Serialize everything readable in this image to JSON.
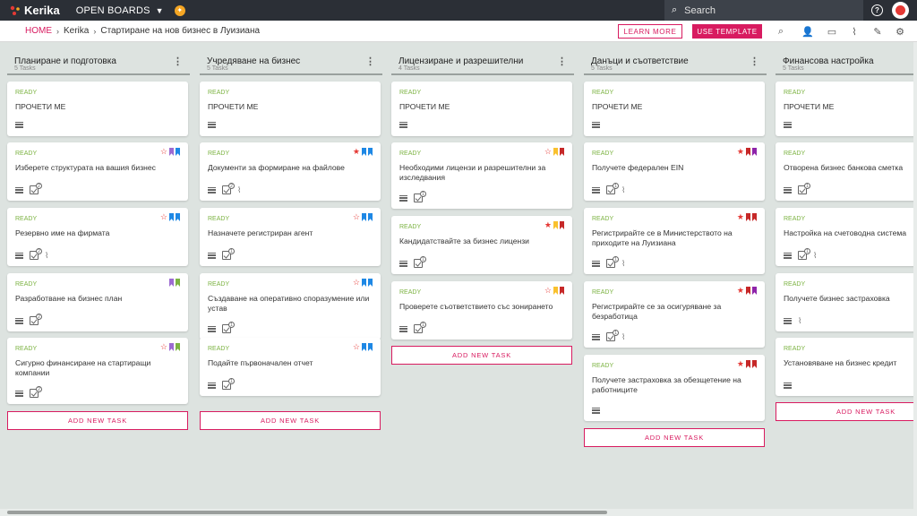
{
  "app": {
    "name": "Kerika"
  },
  "topbar": {
    "boards_label": "OPEN BOARDS",
    "search_placeholder": "Search"
  },
  "breadcrumb": {
    "home": "HOME",
    "items": [
      "Kerika",
      "Стартиране на нов бизнес в Луизиана"
    ]
  },
  "toolbar": {
    "learn_more": "LEARN MORE",
    "use_template": "USE TEMPLATE"
  },
  "icons": [
    "search-icon",
    "add-person-icon",
    "chat-icon",
    "attachment-icon",
    "tools-icon",
    "settings-icon"
  ],
  "colors": {
    "accent": "#d81b60",
    "ready": "#7cb342",
    "star_red": "#e53935",
    "purple": "#9c6ad1",
    "blue": "#1e88e5",
    "green": "#7cb342",
    "yellow": "#f9c12e",
    "darkred": "#c62828",
    "magenta": "#8e24aa"
  },
  "add_task_label": "ADD NEW TASK",
  "columns": [
    {
      "title": "Планиране и подготовка",
      "count": "5 Tasks",
      "cards": [
        {
          "status": "READY",
          "title": "ПРОЧЕТИ МЕ",
          "checklist": null,
          "attachment": false,
          "star": null,
          "flags": []
        },
        {
          "status": "READY",
          "title": "Изберете структурата на вашия бизнес",
          "checklist": "2",
          "attachment": false,
          "star": "outline",
          "flags": [
            "purple",
            "blue"
          ]
        },
        {
          "status": "READY",
          "title": "Резервно име на фирмата",
          "checklist": "2",
          "attachment": true,
          "star": "outline",
          "flags": [
            "blue",
            "blue"
          ]
        },
        {
          "status": "READY",
          "title": "Разработване на бизнес план",
          "checklist": "2",
          "attachment": false,
          "star": null,
          "flags": [
            "purple",
            "green"
          ]
        },
        {
          "status": "READY",
          "title": "Сигурно финансиране на стартиращи компании",
          "checklist": "2",
          "attachment": false,
          "star": "outline",
          "flags": [
            "purple",
            "green"
          ]
        }
      ]
    },
    {
      "title": "Учредяване на бизнес",
      "count": "5 Tasks",
      "cards": [
        {
          "status": "READY",
          "title": "ПРОЧЕТИ МЕ",
          "checklist": null,
          "attachment": false,
          "star": null,
          "flags": []
        },
        {
          "status": "READY",
          "title": "Документи за формиране на файлове",
          "checklist": "2",
          "attachment": true,
          "star": "filled",
          "flags": [
            "blue",
            "blue"
          ]
        },
        {
          "status": "READY",
          "title": "Назначете регистриран агент",
          "checklist": "1",
          "attachment": false,
          "star": "outline",
          "flags": [
            "blue",
            "blue"
          ]
        },
        {
          "status": "READY",
          "title": "Създаване на оперативно споразумение или устав",
          "checklist": "1",
          "attachment": false,
          "star": "outline",
          "flags": [
            "blue",
            "blue"
          ]
        },
        {
          "status": "READY",
          "title": "Подайте първоначален отчет",
          "checklist": "1",
          "attachment": false,
          "star": "outline",
          "flags": [
            "blue",
            "blue"
          ]
        }
      ]
    },
    {
      "title": "Лицензиране и разрешителни",
      "count": "4 Tasks",
      "cards": [
        {
          "status": "READY",
          "title": "ПРОЧЕТИ МЕ",
          "checklist": null,
          "attachment": false,
          "star": null,
          "flags": []
        },
        {
          "status": "READY",
          "title": "Необходими лицензи и разрешителни за изследвания",
          "checklist": "1",
          "attachment": false,
          "star": "outline",
          "flags": [
            "yellow",
            "darkred"
          ]
        },
        {
          "status": "READY",
          "title": "Кандидатствайте за бизнес лицензи",
          "checklist": "1",
          "attachment": false,
          "star": "filled",
          "flags": [
            "yellow",
            "darkred"
          ]
        },
        {
          "status": "READY",
          "title": "Проверете съответствието със зонирането",
          "checklist": "1",
          "attachment": false,
          "star": "outline",
          "flags": [
            "yellow",
            "darkred"
          ]
        }
      ]
    },
    {
      "title": "Данъци и съответствие",
      "count": "5 Tasks",
      "cards": [
        {
          "status": "READY",
          "title": "ПРОЧЕТИ МЕ",
          "checklist": null,
          "attachment": false,
          "star": null,
          "flags": []
        },
        {
          "status": "READY",
          "title": "Получете федерален EIN",
          "checklist": "1",
          "attachment": true,
          "star": "filled",
          "flags": [
            "darkred",
            "magenta"
          ]
        },
        {
          "status": "READY",
          "title": "Регистрирайте се в Министерството на приходите на Луизиана",
          "checklist": "1",
          "attachment": true,
          "star": "filled",
          "flags": [
            "darkred",
            "darkred"
          ]
        },
        {
          "status": "READY",
          "title": "Регистрирайте се за осигуряване за безработица",
          "checklist": "1",
          "attachment": true,
          "star": "filled",
          "flags": [
            "darkred",
            "magenta"
          ]
        },
        {
          "status": "READY",
          "title": "Получете застраховка за обезщетение на работниците",
          "checklist": null,
          "attachment": false,
          "star": "filled",
          "flags": [
            "darkred",
            "darkred"
          ]
        }
      ]
    },
    {
      "title": "Финансова настройка",
      "count": "5 Tasks",
      "cards": [
        {
          "status": "READY",
          "title": "ПРОЧЕТИ МЕ",
          "checklist": null,
          "attachment": false,
          "star": null,
          "flags": []
        },
        {
          "status": "READY",
          "title": "Отворена бизнес банкова сметка",
          "checklist": "1",
          "attachment": false,
          "star": null,
          "flags": []
        },
        {
          "status": "READY",
          "title": "Настройка на счетоводна система",
          "checklist": "1",
          "attachment": true,
          "star": null,
          "flags": []
        },
        {
          "status": "READY",
          "title": "Получете бизнес застраховка",
          "checklist": null,
          "attachment": true,
          "star": null,
          "flags": []
        },
        {
          "status": "READY",
          "title": "Установяване на бизнес кредит",
          "checklist": null,
          "attachment": false,
          "star": null,
          "flags": []
        }
      ]
    }
  ]
}
